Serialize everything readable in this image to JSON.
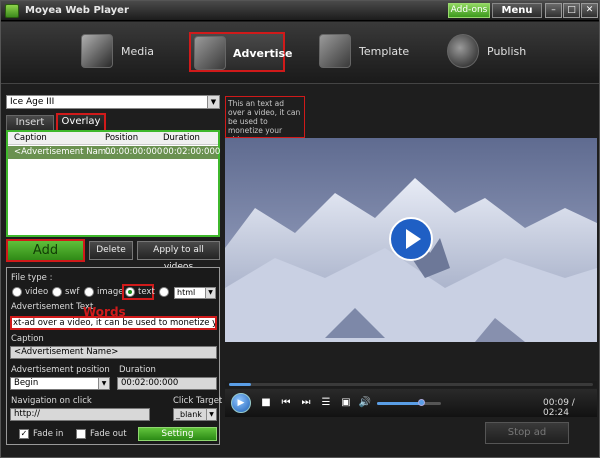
{
  "window": {
    "title": "Moyea Web Player",
    "addons_label": "Add-ons",
    "menu_label": "Menu",
    "minimize_label": "–",
    "maximize_label": "□",
    "close_label": "✕"
  },
  "steps": [
    {
      "label": "Media",
      "icon": "film-reel-icon"
    },
    {
      "label": "Advertise",
      "icon": "media-stack-icon"
    },
    {
      "label": "Template",
      "icon": "template-icon"
    },
    {
      "label": "Publish",
      "icon": "publish-icon"
    }
  ],
  "active_step": "Advertise",
  "clip_select": {
    "value": "Ice Age III"
  },
  "tabs": {
    "insert": "Insert",
    "overlay": "Overlay"
  },
  "ad_list": {
    "columns": [
      "Caption",
      "Position",
      "Duration"
    ],
    "rows": [
      {
        "caption": "<Advertisement Nam...",
        "position": "00:00:00:000",
        "duration": "00:02:00:000"
      }
    ]
  },
  "list_buttons": {
    "add": "Add",
    "delete": "Delete",
    "apply_all": "Apply to all videos"
  },
  "settings": {
    "file_type_label": "File type :",
    "file_types": [
      "video",
      "swf",
      "image",
      "text",
      "html"
    ],
    "selected_file_type": "text",
    "html_select_value": "html",
    "ad_text_label": "Advertisement Text",
    "words_annotation": "Words",
    "ad_text_value": "xt-ad over a video, it can be used to monetize your video",
    "caption_label": "Caption",
    "caption_value": "<Advertisement Name>",
    "position_label": "Advertisement position",
    "position_value": "Begin",
    "duration_label": "Duration",
    "duration_value": "00:02:00:000",
    "navigation_label": "Navigation on click",
    "navigation_value": "http://",
    "click_target_label": "Click Target",
    "click_target_value": "_blank",
    "fade_in_label": "Fade in",
    "fade_in_checked": true,
    "fade_out_label": "Fade out",
    "fade_out_checked": false,
    "setting_button": "Setting"
  },
  "preview": {
    "overlay_text": "This an text ad over a video, it can be used to monetize your video",
    "progress_fraction": 0.06,
    "volume_fraction": 0.7,
    "time_display": "00:09 / 02:24",
    "stop_ad": "Stop ad"
  },
  "colors": {
    "highlight_red": "#d01a1a",
    "accent_green": "#3fb82c",
    "accent_blue": "#5a9ee6"
  }
}
